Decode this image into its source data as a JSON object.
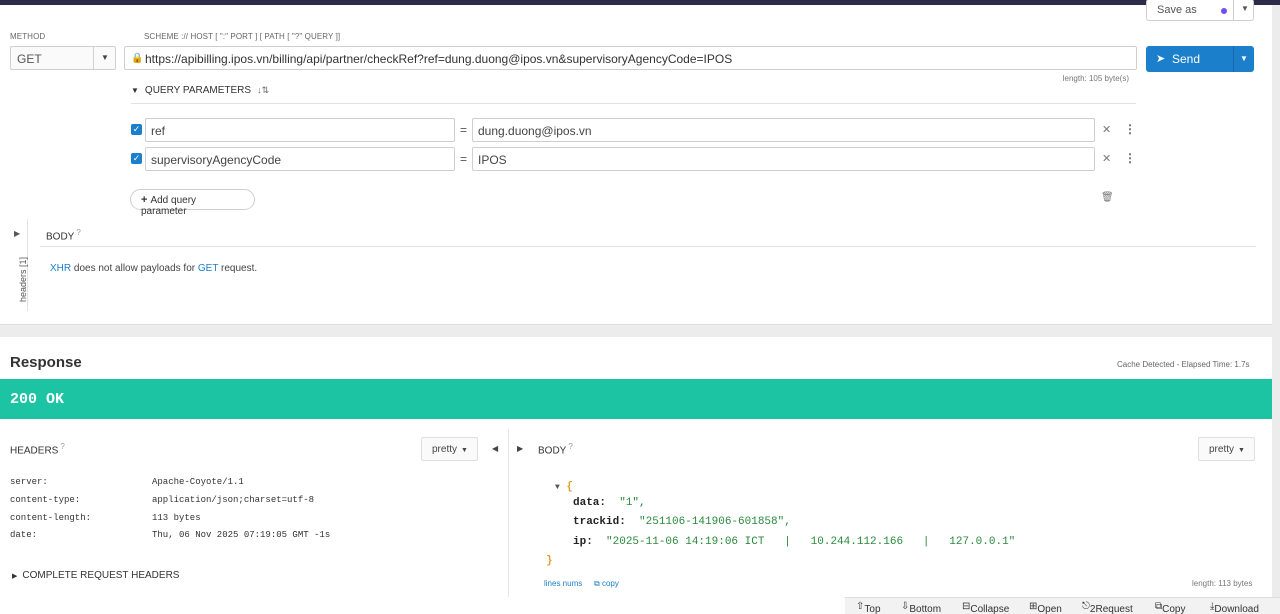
{
  "request": {
    "method_label": "METHOD",
    "method_value": "GET",
    "scheme_label": "SCHEME :// HOST [ \":\" PORT ] [ PATH [ \"?\" QUERY ]]",
    "url": "https://apibilling.ipos.vn/billing/api/partner/checkRef?ref=dung.duong@ipos.vn&supervisoryAgencyCode=IPOS",
    "length_note": "length: 105 byte(s)",
    "save_as_label": "Save as",
    "send_label": "Send",
    "query_params_label": "QUERY PARAMETERS",
    "params": [
      {
        "name": "ref",
        "value": "dung.duong@ipos.vn"
      },
      {
        "name": "supervisoryAgencyCode",
        "value": "IPOS"
      }
    ],
    "add_param_label": "Add query parameter",
    "body_label": "BODY",
    "headers_side_label": "headers [1]",
    "xhr_note": {
      "part1": "XHR",
      "part2": " does not allow payloads for ",
      "part3": "GET",
      "part4": " request."
    }
  },
  "response": {
    "title": "Response",
    "cache_note": "Cache Detected - Elapsed Time: 1.7s",
    "status": "200 OK",
    "status_color": "#1cc4a4",
    "headers_label": "HEADERS",
    "pretty_label": "pretty",
    "headers": [
      {
        "key": "server:",
        "value": "Apache-Coyote/1.1"
      },
      {
        "key": "content-type:",
        "value": "application/json;charset=utf-8"
      },
      {
        "key": "content-length:",
        "value": "113 bytes"
      },
      {
        "key": "date:",
        "value": "Thu, 06 Nov 2025 07:19:05 GMT -1s"
      }
    ],
    "complete_headers_label": "COMPLETE REQUEST HEADERS",
    "body_label": "BODY",
    "json": {
      "data_key": "data:",
      "data_val": "\"1\",",
      "trackid_key": "trackid:",
      "trackid_val": "\"251106-141906-601858\",",
      "ip_key": "ip:",
      "ip_val": "\"2025-11-06 14:19:06 ICT   |   10.244.112.166   |   127.0.0.1\""
    },
    "lines_nums_label": "lines nums",
    "copy_label": "copy",
    "length_note": "length: 113 bytes"
  },
  "bottom_bar": {
    "top": "Top",
    "bottom": "Bottom",
    "collapse": "Collapse",
    "open": "Open",
    "request": "2Request",
    "copy": "Copy",
    "download": "Download"
  },
  "colors": {
    "accent": "#1b7fcc",
    "success": "#1cc4a4"
  }
}
